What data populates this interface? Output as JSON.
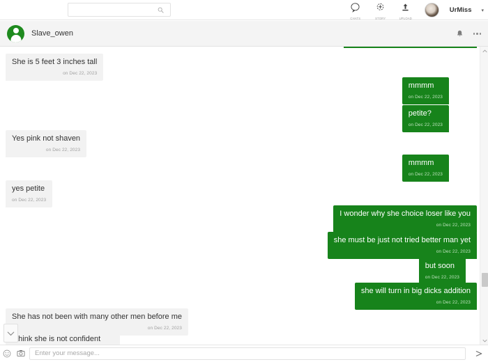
{
  "topnav": {
    "search": {
      "value": "",
      "placeholder": ""
    },
    "actions": [
      {
        "id": "chats",
        "icon": "chat-icon",
        "label": "CHATS"
      },
      {
        "id": "story",
        "icon": "story-icon",
        "label": "STORY"
      },
      {
        "id": "upload",
        "icon": "upload-icon",
        "label": "UPLOAD"
      }
    ],
    "account": {
      "username": "UrMiss",
      "caret": "▾"
    }
  },
  "chat_header": {
    "peer_name": "Slave_owen",
    "notification_icon": "bell-icon",
    "more_icon": "more-options-icon"
  },
  "conversation": {
    "partial_top_label": "",
    "messages": [
      {
        "id": "m1",
        "side": "left",
        "text": "She is 5 feet 3 inches tall",
        "time": "on Dec 22, 2023"
      },
      {
        "id": "m2",
        "side": "right",
        "text": "mmmm",
        "time": "on Dec 22, 2023"
      },
      {
        "id": "m3",
        "side": "right",
        "text": "petite?",
        "time": "on Dec 22, 2023"
      },
      {
        "id": "m4",
        "side": "left",
        "text": "Yes pink not shaven",
        "time": "on Dec 22, 2023"
      },
      {
        "id": "m5",
        "side": "right",
        "text": "mmmm",
        "time": "on Dec 22, 2023"
      },
      {
        "id": "m6",
        "side": "left",
        "text": "yes petite",
        "time": "on Dec 22, 2023"
      },
      {
        "id": "m7",
        "side": "right",
        "text": "I wonder why she choice loser like you",
        "time": "on Dec 22, 2023"
      },
      {
        "id": "m8",
        "side": "right",
        "text": "she must be just not tried better man yet",
        "time": "on Dec 22, 2023"
      },
      {
        "id": "m9",
        "side": "right",
        "text": "but soon",
        "time": "on Dec 22, 2023"
      },
      {
        "id": "m10",
        "side": "right",
        "text": "she will turn in big dicks addition",
        "time": "on Dec 22, 2023"
      },
      {
        "id": "m11",
        "side": "left",
        "text": "She has not been with many other men before me",
        "time": "on Dec 22, 2023"
      }
    ],
    "partial_bottom_text": "I think she is not confident",
    "scroll_down_icon": "chevron-down-icon"
  },
  "composer": {
    "emoji_icon": "emoji-icon",
    "camera_icon": "camera-icon",
    "input_value": "",
    "input_placeholder": "Enter your message...",
    "send_icon": "send-icon"
  },
  "colors": {
    "accent_green": "#17831b",
    "avatar_green": "#1e8a1e",
    "left_bubble": "#f2f2f2",
    "header_bg": "#f4f4f4"
  }
}
